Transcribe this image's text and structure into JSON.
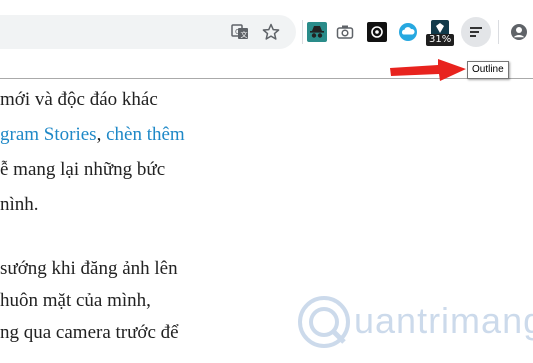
{
  "toolbar": {
    "extension_badge": "31%",
    "icons": [
      "translate-icon",
      "star-icon",
      "incognito-extension-icon",
      "camera-icon",
      "extension-icon",
      "cloud-extension-icon",
      "extension-icon",
      "outline-icon",
      "profile-icon"
    ]
  },
  "tooltip": {
    "label": "Outline"
  },
  "annotation": {
    "arrow_color": "#e8231e"
  },
  "article": {
    "lines": {
      "l1": "mới và độc đáo khác",
      "l2_link1": "gram Stories",
      "l2_sep": ", ",
      "l2_link2": "chèn thêm",
      "l3": "ễ mang lại những bức",
      "l4": "nình.",
      "l5": "sướng khi đăng ảnh lên",
      "l6": "huôn mặt của mình,",
      "l7": "ng qua camera trước để"
    },
    "link_color": "#1e88c7"
  },
  "watermark": {
    "text": "uantrimang"
  }
}
